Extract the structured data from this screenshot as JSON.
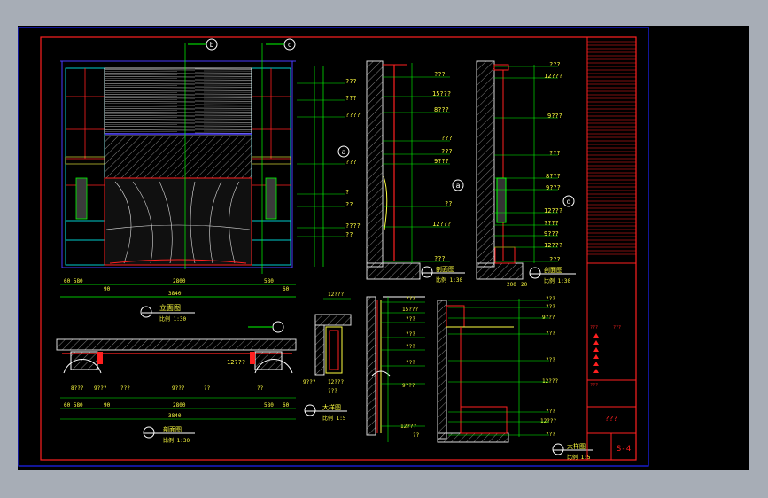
{
  "colors": {
    "background": "#a7adb6",
    "viewport": "#000000",
    "frame_blue": "#1f24ff",
    "border_red": "#ff2020",
    "dim_green": "#00ff00",
    "outline_blue": "#4a3cff",
    "label_yellow": "#ffff40",
    "hatch_white": "#d8d8d8",
    "cyan": "#00ffff"
  },
  "elevation_marks": {
    "top_left": "b",
    "top_right": "c",
    "side_left": "a",
    "side_mid": "a",
    "side_right": "d"
  },
  "front_elevation": {
    "caption": "立面图",
    "scale": "比例 1:30",
    "bottom_dims": [
      "60 580",
      "90",
      "2800",
      "580",
      "60"
    ],
    "total_dim": "3840",
    "side_dims": [
      "??? ",
      "???",
      "????",
      "???",
      "?",
      "??",
      "????",
      "??"
    ]
  },
  "section_b": {
    "caption": "剖面图",
    "scale": "比例 1:30",
    "dims": [
      "???",
      "15???",
      "8???",
      "???",
      "???",
      "9???",
      "??",
      "12???",
      "???"
    ]
  },
  "section_c": {
    "caption": "剖面图",
    "scale": "比例 1:30",
    "bottom_dims": [
      "200",
      "20"
    ],
    "dims": [
      "???",
      "12???",
      "9???",
      "???",
      "8???",
      "9???",
      "12???",
      "????",
      "9???",
      "12???",
      "???"
    ]
  },
  "plan": {
    "caption": "剖面图",
    "scale": "比例 1:30",
    "callout": "12???",
    "dims": [
      "8???",
      "9???",
      "???",
      "9???",
      "??",
      "??"
    ],
    "bottom_dims": [
      "60 580",
      "90",
      "2800",
      "580",
      "60"
    ],
    "total_dim": "3840"
  },
  "detail_small": {
    "caption": "大样图",
    "scale": "比例 1:5",
    "top": "12???",
    "bottom_dims": [
      "9???",
      "12???",
      "???"
    ]
  },
  "detail_mid": {
    "caption": "大样图",
    "scale": "比例 1:5",
    "dims": [
      "???",
      "15???",
      "???",
      "???",
      "???",
      "???",
      "9???",
      "12???",
      "??"
    ]
  },
  "detail_right": {
    "caption": "大样图",
    "scale": "比例 1:5",
    "dims": [
      "???",
      "???",
      "9???",
      "???",
      "???",
      "12???",
      "???",
      "12???",
      "???"
    ]
  },
  "title_block": {
    "project": "???",
    "drawing_no": "S-4",
    "small_texts": [
      "???",
      "???",
      "???"
    ]
  }
}
